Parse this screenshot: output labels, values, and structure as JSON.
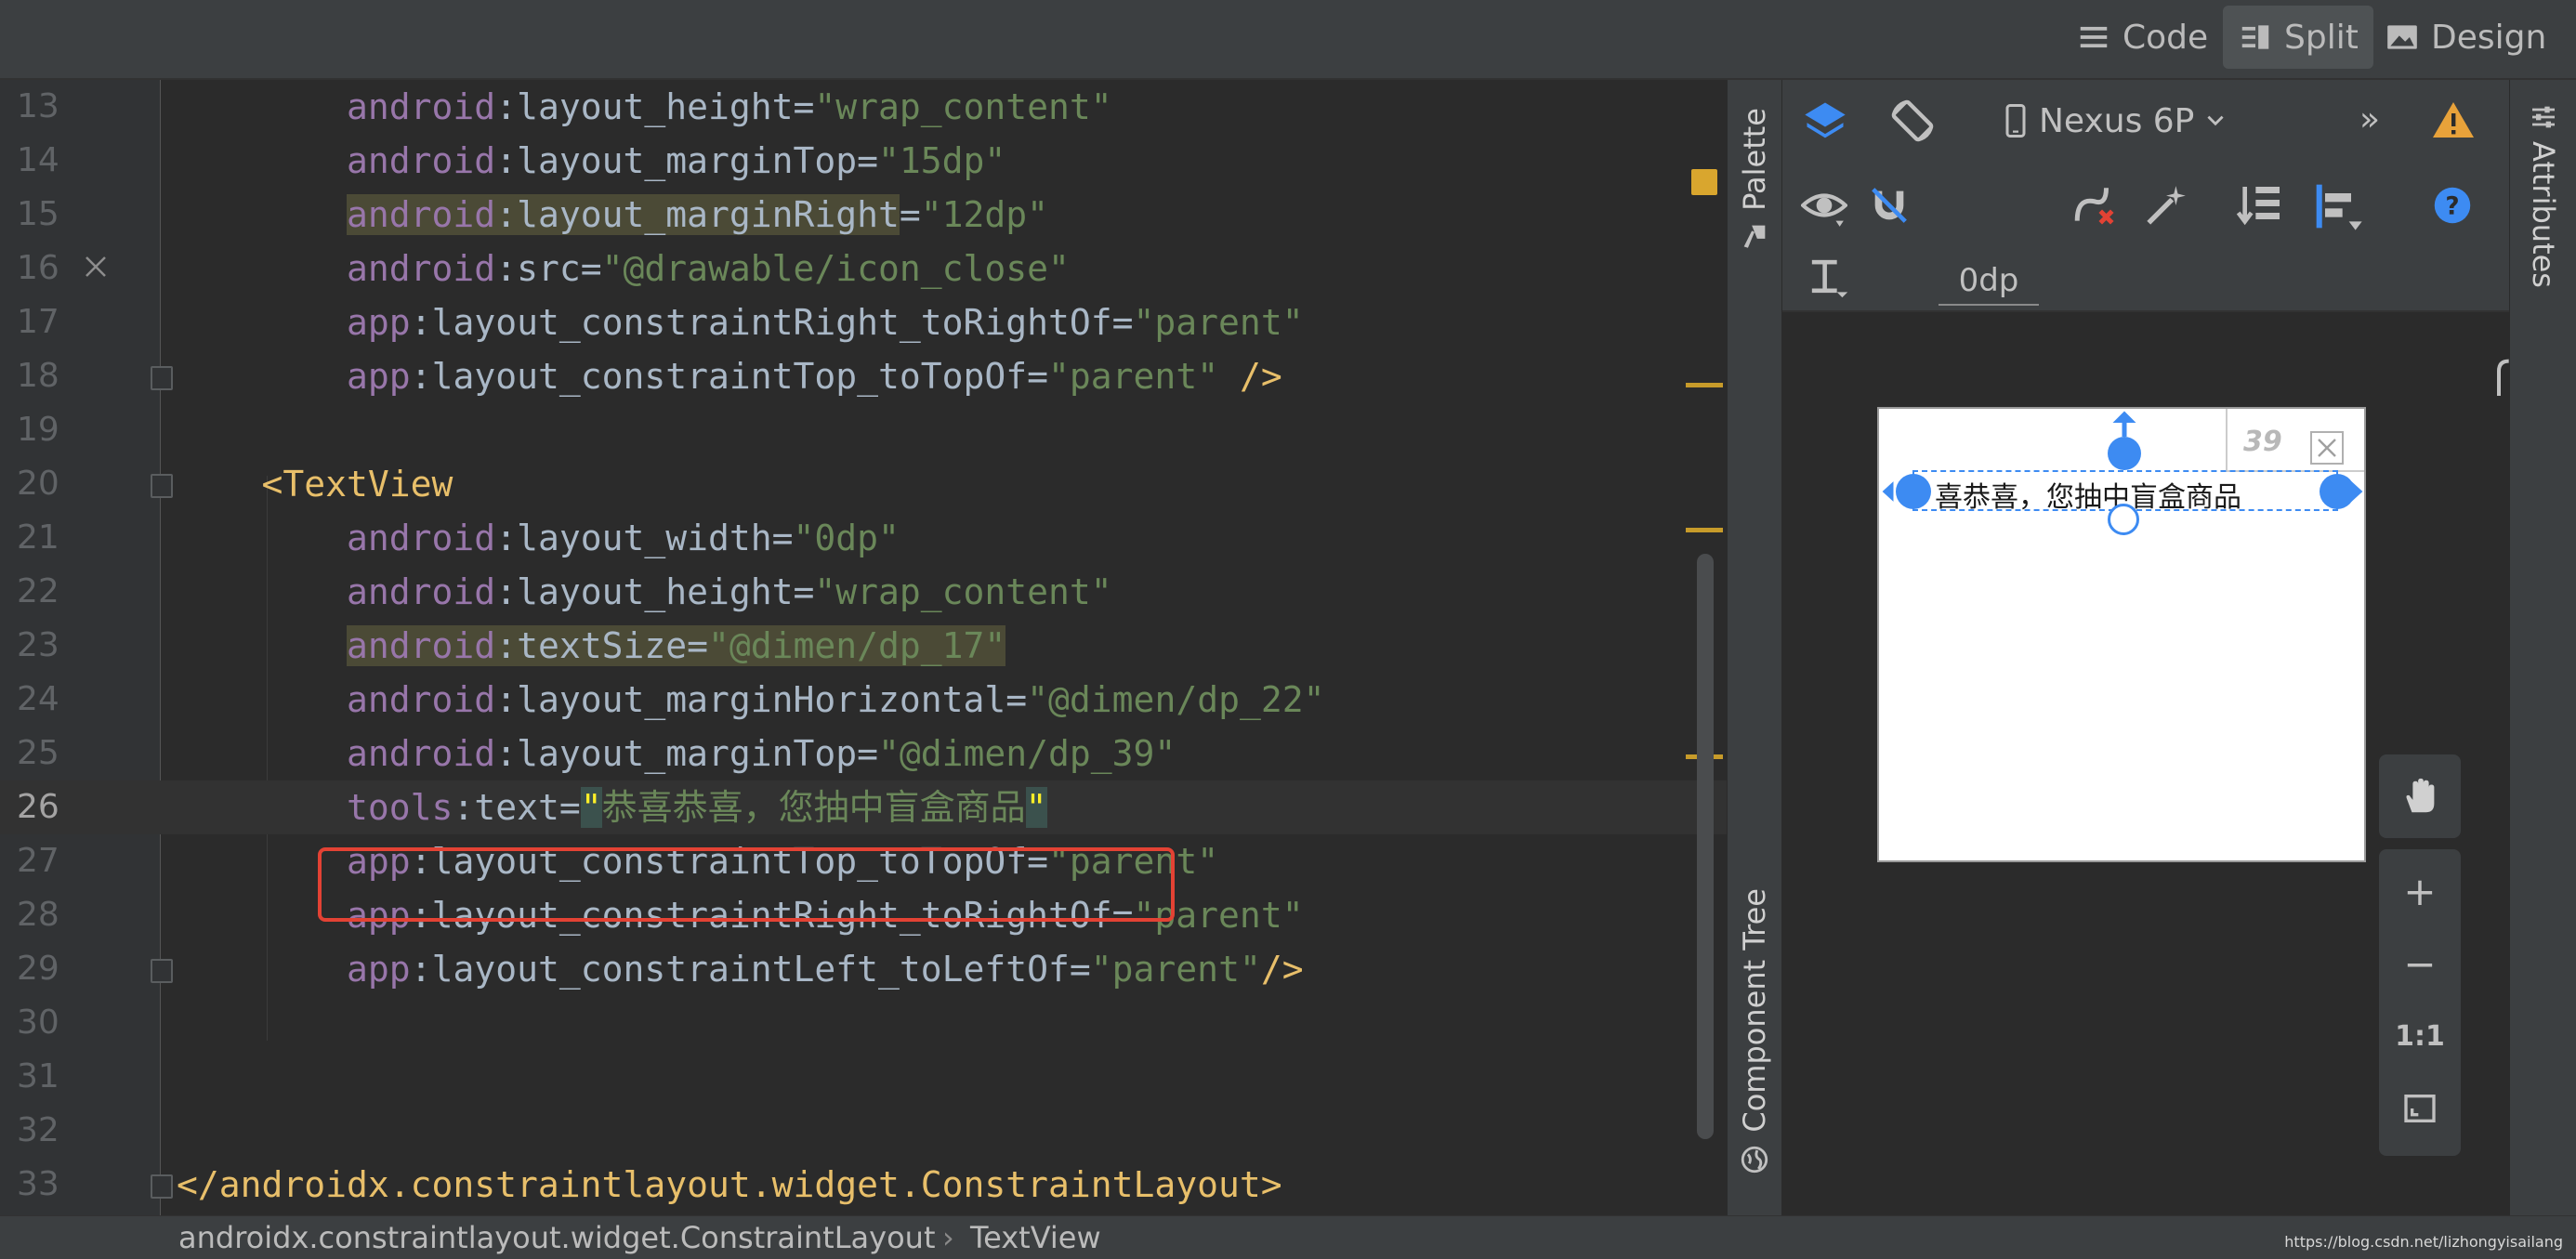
{
  "view_modes": {
    "code": "Code",
    "split": "Split",
    "design": "Design"
  },
  "editor": {
    "lines": [
      {
        "n": "13",
        "parts": [
          [
            "ns",
            "android"
          ],
          [
            "pu",
            ":"
          ],
          [
            "pu",
            "layout_height"
          ],
          [
            "pu",
            "="
          ],
          [
            "str",
            "\"wrap_content\""
          ]
        ]
      },
      {
        "n": "14",
        "parts": [
          [
            "ns",
            "android"
          ],
          [
            "pu",
            ":"
          ],
          [
            "pu",
            "layout_marginTop"
          ],
          [
            "pu",
            "="
          ],
          [
            "str",
            "\"15dp\""
          ]
        ]
      },
      {
        "n": "15",
        "parts": [
          [
            "ns hl",
            "android"
          ],
          [
            "pu hl",
            ":"
          ],
          [
            "pu hl",
            "layout_marginRight"
          ],
          [
            "pu",
            "="
          ],
          [
            "str",
            "\"12dp\""
          ]
        ]
      },
      {
        "n": "16",
        "parts": [
          [
            "ns",
            "android"
          ],
          [
            "pu",
            ":"
          ],
          [
            "pu",
            "src"
          ],
          [
            "pu",
            "="
          ],
          [
            "str",
            "\"@drawable/icon_close\""
          ]
        ]
      },
      {
        "n": "17",
        "parts": [
          [
            "ns",
            "app"
          ],
          [
            "pu",
            ":"
          ],
          [
            "pu",
            "layout_constraintRight_toRightOf"
          ],
          [
            "pu",
            "="
          ],
          [
            "str",
            "\"parent\""
          ]
        ]
      },
      {
        "n": "18",
        "parts": [
          [
            "ns",
            "app"
          ],
          [
            "pu",
            ":"
          ],
          [
            "pu",
            "layout_constraintTop_toTopOf"
          ],
          [
            "pu",
            "="
          ],
          [
            "str",
            "\"parent\""
          ],
          [
            "tag",
            " />"
          ]
        ]
      },
      {
        "n": "19",
        "parts": []
      },
      {
        "n": "20",
        "parts": [
          [
            "tag",
            "<TextView"
          ]
        ]
      },
      {
        "n": "21",
        "parts": [
          [
            "ns",
            "android"
          ],
          [
            "pu",
            ":"
          ],
          [
            "pu",
            "layout_width"
          ],
          [
            "pu",
            "="
          ],
          [
            "str",
            "\"0dp\""
          ]
        ]
      },
      {
        "n": "22",
        "parts": [
          [
            "ns",
            "android"
          ],
          [
            "pu",
            ":"
          ],
          [
            "pu",
            "layout_height"
          ],
          [
            "pu",
            "="
          ],
          [
            "str",
            "\"wrap_content\""
          ]
        ]
      },
      {
        "n": "23",
        "parts": [
          [
            "ns hl",
            "android"
          ],
          [
            "pu hl",
            ":"
          ],
          [
            "pu hl",
            "textSize"
          ],
          [
            "pu hl",
            "="
          ],
          [
            "str hl",
            "\"@dimen/dp_17\""
          ]
        ]
      },
      {
        "n": "24",
        "parts": [
          [
            "ns",
            "android"
          ],
          [
            "pu",
            ":"
          ],
          [
            "pu",
            "layout_marginHorizontal"
          ],
          [
            "pu",
            "="
          ],
          [
            "str",
            "\"@dimen/dp_22\""
          ]
        ]
      },
      {
        "n": "25",
        "parts": [
          [
            "ns",
            "android"
          ],
          [
            "pu",
            ":"
          ],
          [
            "pu",
            "layout_marginTop"
          ],
          [
            "pu",
            "="
          ],
          [
            "str",
            "\"@dimen/dp_39\""
          ]
        ]
      },
      {
        "n": "26",
        "parts": [
          [
            "ns",
            "tools"
          ],
          [
            "pu",
            ":"
          ],
          [
            "pu",
            "text"
          ],
          [
            "pu",
            "="
          ],
          [
            "q",
            "\""
          ],
          [
            "str",
            "恭喜恭喜，您抽中盲盒商品"
          ],
          [
            "q",
            "\""
          ]
        ]
      },
      {
        "n": "27",
        "parts": [
          [
            "ns",
            "app"
          ],
          [
            "pu",
            ":"
          ],
          [
            "pu",
            "layout_constraintTop_toTopOf"
          ],
          [
            "pu",
            "="
          ],
          [
            "str",
            "\"parent\""
          ]
        ]
      },
      {
        "n": "28",
        "parts": [
          [
            "ns",
            "app"
          ],
          [
            "pu",
            ":"
          ],
          [
            "pu",
            "layout_constraintRight_toRightOf"
          ],
          [
            "pu",
            "="
          ],
          [
            "str",
            "\"parent\""
          ]
        ]
      },
      {
        "n": "29",
        "parts": [
          [
            "ns",
            "app"
          ],
          [
            "pu",
            ":"
          ],
          [
            "pu",
            "layout_constraintLeft_toLeftOf"
          ],
          [
            "pu",
            "="
          ],
          [
            "str",
            "\"parent\""
          ],
          [
            "tag",
            "/>"
          ]
        ]
      },
      {
        "n": "30",
        "parts": []
      },
      {
        "n": "31",
        "parts": []
      },
      {
        "n": "32",
        "parts": []
      },
      {
        "n": "33",
        "parts": [
          [
            "tag",
            "</androidx.constraintlayout.widget.ConstraintLayout>"
          ]
        ]
      }
    ]
  },
  "breadcrumb": {
    "item1": "androidx.constraintlayout.widget.ConstraintLayout",
    "separator": "›",
    "item2": "TextView"
  },
  "watermark": "https://blog.csdn.net/lizhongyisailang",
  "side_tabs": {
    "palette": "Palette",
    "component_tree": "Component Tree",
    "attributes": "Attributes"
  },
  "design_toolbar": {
    "device": "Nexus 6P",
    "default_margin": "0dp",
    "overflow": "»",
    "help": "?"
  },
  "preview": {
    "text": "喜恭喜，您抽中盲盒商品",
    "margin_label": "39"
  },
  "zoom": {
    "zoom_in": "+",
    "zoom_out": "−",
    "actual_size": "1:1"
  },
  "colors": {
    "accent_blue": "#3d8bf2",
    "highlight_red": "#e34234",
    "warning": "#e8a23a"
  }
}
